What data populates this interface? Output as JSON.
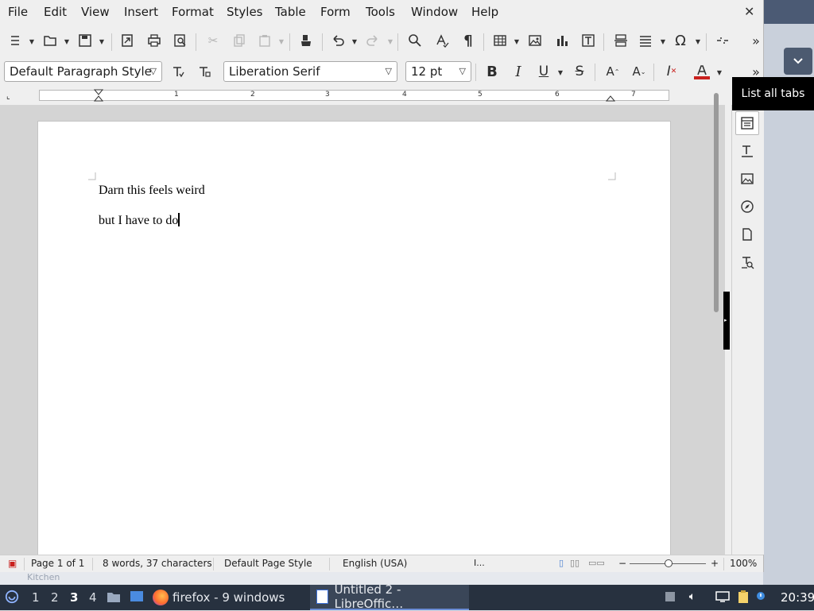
{
  "window": {
    "close_glyph": "✕"
  },
  "menu": [
    "File",
    "Edit",
    "View",
    "Insert",
    "Format",
    "Styles",
    "Table",
    "Form",
    "Tools",
    "Window",
    "Help"
  ],
  "formatting": {
    "paragraph_style": "Default Paragraph Style",
    "font_name": "Liberation Serif",
    "font_size": "12 pt"
  },
  "ruler": {
    "numbers": [
      "1",
      "2",
      "3",
      "4",
      "5",
      "6",
      "7"
    ]
  },
  "document": {
    "paragraphs": [
      "Darn this feels weird",
      "but I have to do"
    ]
  },
  "sidebar": {
    "tooltip": "List all tabs"
  },
  "status": {
    "page": "Page 1 of 1",
    "words": "8 words, 37 characters",
    "page_style": "Default Page Style",
    "language": "English (USA)",
    "zoom": "100%",
    "zoom_minus": "−",
    "zoom_plus": "+"
  },
  "taskbar": {
    "workspaces": [
      "1",
      "2",
      "3",
      "4"
    ],
    "current_workspace": "3",
    "firefox_label": "firefox - 9 windows",
    "libreoffice_label": "Untitled 2 - LibreOffic…",
    "clock": "20:39"
  },
  "background": {
    "ghost_text": "Kitchen"
  },
  "colors": {
    "font_color_underline": "#c9211e",
    "taskbar_bg": "#27313f",
    "accent": "#6b8dd6"
  },
  "icons": {
    "toolbar1": [
      "sidebar-toggle-icon",
      "open-folder-icon",
      "save-icon",
      "export-pdf-icon",
      "print-icon",
      "print-preview-icon",
      "cut-icon",
      "copy-icon",
      "paste-icon",
      "clone-formatting-icon",
      "undo-icon",
      "redo-icon",
      "find-replace-icon",
      "spelling-icon",
      "formatting-marks-icon",
      "insert-table-icon",
      "insert-image-icon",
      "insert-chart-icon",
      "insert-textbox-icon",
      "page-break-icon",
      "insert-field-icon",
      "special-character-icon",
      "hyperlink-icon",
      "more-icon"
    ],
    "toolbar2": [
      "update-style-icon",
      "new-style-icon",
      "bold-icon",
      "italic-icon",
      "underline-icon",
      "strikethrough-icon",
      "superscript-icon",
      "subscript-icon",
      "clear-formatting-icon",
      "font-color-icon",
      "more-icon"
    ],
    "sidebar": [
      "properties-icon",
      "styles-icon",
      "gallery-icon",
      "navigator-icon",
      "page-icon",
      "style-inspector-icon"
    ]
  }
}
